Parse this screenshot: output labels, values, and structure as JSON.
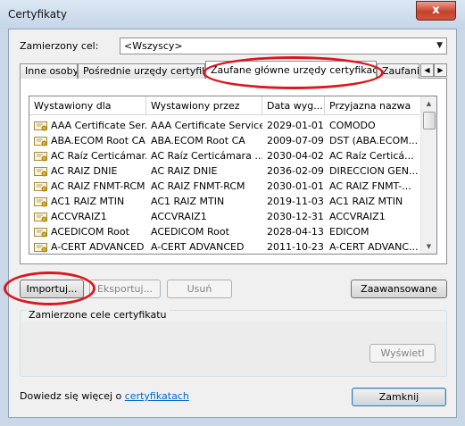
{
  "window": {
    "title": "Certyfikaty",
    "close_glyph": "x"
  },
  "intended_purpose": {
    "label": "Zamierzony cel:",
    "value": "<Wszyscy>"
  },
  "tabs": [
    {
      "label": "Inne osoby"
    },
    {
      "label": "Pośrednie urzędy certyfikacji"
    },
    {
      "label": "Zaufane główne urzędy certyfikacji"
    },
    {
      "label": "Zaufani w"
    }
  ],
  "table": {
    "columns": [
      "Wystawiony dla",
      "Wystawiony przez",
      "Data wyg...",
      "Przyjazna nazwa"
    ],
    "rows": [
      {
        "issued_to": "AAA Certificate Ser...",
        "issued_by": "AAA Certificate Services",
        "expires": "2029-01-01",
        "friendly": "COMODO"
      },
      {
        "issued_to": "ABA.ECOM Root CA",
        "issued_by": "ABA.ECOM Root CA",
        "expires": "2009-07-09",
        "friendly": "DST (ABA.ECOM..."
      },
      {
        "issued_to": "AC Raíz Certicámar...",
        "issued_by": "AC Raíz Certicámara ...",
        "expires": "2030-04-02",
        "friendly": "AC Raíz Certicá..."
      },
      {
        "issued_to": "AC RAIZ DNIE",
        "issued_by": "AC RAIZ DNIE",
        "expires": "2036-02-09",
        "friendly": "DIRECCION GEN..."
      },
      {
        "issued_to": "AC RAIZ FNMT-RCM",
        "issued_by": "AC RAIZ FNMT-RCM",
        "expires": "2030-01-01",
        "friendly": "AC RAIZ FNMT-..."
      },
      {
        "issued_to": "AC1 RAIZ MTIN",
        "issued_by": "AC1 RAIZ MTIN",
        "expires": "2019-11-03",
        "friendly": "AC1 RAIZ MTIN"
      },
      {
        "issued_to": "ACCVRAIZ1",
        "issued_by": "ACCVRAIZ1",
        "expires": "2030-12-31",
        "friendly": "ACCVRAIZ1"
      },
      {
        "issued_to": "ACEDICOM Root",
        "issued_by": "ACEDICOM Root",
        "expires": "2028-04-13",
        "friendly": "EDICOM"
      },
      {
        "issued_to": "A-CERT ADVANCED",
        "issued_by": "A-CERT ADVANCED",
        "expires": "2011-10-23",
        "friendly": "A-CERT ADVANC..."
      }
    ]
  },
  "buttons": {
    "import": "Importuj...",
    "export": "Eksportuj...",
    "remove": "Usuń",
    "advanced": "Zaawansowane",
    "view": "Wyświetl",
    "close": "Zamknij"
  },
  "purposes_group": {
    "title": "Zamierzone cele certyfikatu"
  },
  "footer": {
    "text": "Dowiedz się więcej o ",
    "link": "certyfikatach"
  },
  "colors": {
    "highlight_ellipse": "#d8191f",
    "link": "#0066cc"
  }
}
